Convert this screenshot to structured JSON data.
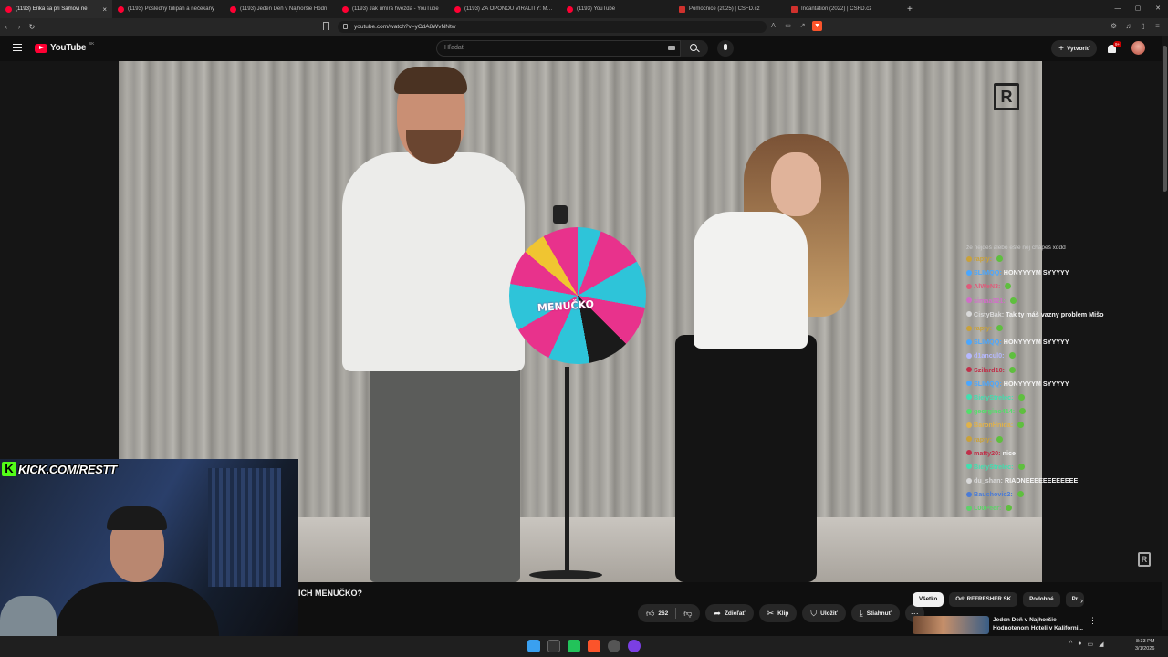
{
  "browser": {
    "tabs": [
      {
        "title": "(1193) Erika sa pri Samovi ne",
        "active": true,
        "kind": "youtube"
      },
      {
        "title": "(1193) Posledný tulipán a nečekaný",
        "active": false,
        "kind": "youtube"
      },
      {
        "title": "(1193) Jeden Deň v Najhoršie Hodn",
        "active": false,
        "kind": "youtube"
      },
      {
        "title": "(1193) Jak umírá hvězda - YouTube",
        "active": false,
        "kind": "youtube"
      },
      {
        "title": "(1193) ZA OPONOU VIRALITY: MELE",
        "active": false,
        "kind": "youtube"
      },
      {
        "title": "(1193) YouTube",
        "active": false,
        "kind": "youtube"
      },
      {
        "title": "Pomocnice (2025) | ČSFD.cz",
        "active": false,
        "kind": "csfd"
      },
      {
        "title": "Incantation (2022) | ČSFD.cz",
        "active": false,
        "kind": "csfd"
      }
    ],
    "url": "youtube.com/watch?v=yCdA8WvNNtw"
  },
  "youtube": {
    "logo_text": "YouTube",
    "country": "SK",
    "search_placeholder": "Hľadať",
    "create_label": "Vytvoriť",
    "notif_count": "9+"
  },
  "video": {
    "wheel_label": "MENUČKO",
    "watermark": "R",
    "corner_mark": "R",
    "title_fragment": "ICH MENUČKO?"
  },
  "overlay": {
    "kick_handle": "KICK.COM/RESTT",
    "chat_header": "že nejdeš alebo ešte nej chápeš xddd",
    "chat": [
      {
        "user": "rapty:",
        "text": "",
        "color": "#c9a13a",
        "emote": true
      },
      {
        "user": "SLIMQQ:",
        "text": "HONYYYYM SYYYYY",
        "color": "#4aa7ff",
        "emote": false
      },
      {
        "user": "AlWeN3:",
        "text": "",
        "color": "#e05a7a",
        "emote": true
      },
      {
        "user": "simaa321:",
        "text": "",
        "color": "#d06fc7",
        "emote": true
      },
      {
        "user": "CistyBak:",
        "text": "Tak ty máš vazny problem Mišo",
        "color": "#d9d9d9",
        "emote": false
      },
      {
        "user": "rapty:",
        "text": "",
        "color": "#c9a13a",
        "emote": true
      },
      {
        "user": "SLIMQQ:",
        "text": "HONYYYYM SYYYYY",
        "color": "#4aa7ff",
        "emote": false
      },
      {
        "user": "d1ancul0:",
        "text": "",
        "color": "#b5b8ff",
        "emote": true
      },
      {
        "user": "Szilard10:",
        "text": "",
        "color": "#c0304a",
        "emote": true
      },
      {
        "user": "SLIMQQ:",
        "text": "HONYYYYM SYYYYY",
        "color": "#4aa7ff",
        "emote": false
      },
      {
        "user": "BielyStrelec:",
        "text": "",
        "color": "#41e0b0",
        "emote": true
      },
      {
        "user": "georgino414:",
        "text": "",
        "color": "#52e06a",
        "emote": true
      },
      {
        "user": "BaronHnida:",
        "text": "",
        "color": "#e0b24a",
        "emote": true
      },
      {
        "user": "rapty:",
        "text": "",
        "color": "#c9a13a",
        "emote": true
      },
      {
        "user": "matty20:",
        "text": "nice",
        "color": "#c0304a",
        "emote": false
      },
      {
        "user": "BielyStrelec:",
        "text": "",
        "color": "#41e0b0",
        "emote": true
      },
      {
        "user": "du_shan:",
        "text": "RIADNEEEEEEEEEEEE",
        "color": "#d9d9d9",
        "emote": false
      },
      {
        "user": "Bauchovic2:",
        "text": "",
        "color": "#4a7bd6",
        "emote": true
      },
      {
        "user": "L00Peer:",
        "text": "",
        "color": "#5fd06a",
        "emote": true
      }
    ]
  },
  "actions": {
    "like_count": "262",
    "share": "Zdieľať",
    "clip": "Klip",
    "save": "Uložiť",
    "download": "Stiahnuť"
  },
  "chips": [
    "Všetko",
    "Od: REFRESHER SK",
    "Podobné",
    "Pr"
  ],
  "recommendation": {
    "title_line1": "Jeden Deň v Najhoršie",
    "title_line2": "Hodnotenom Hoteli v Kaliforni..."
  },
  "clock": {
    "time": "8:33 PM",
    "date": "3/1/2026"
  }
}
